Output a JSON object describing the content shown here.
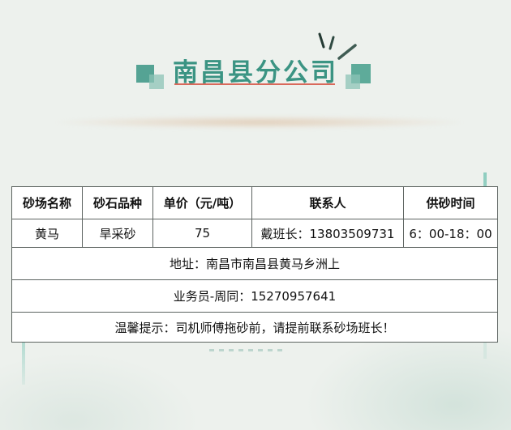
{
  "title": "南昌县分公司",
  "colors": {
    "title": "#3b9483",
    "underline": "#d9695b",
    "accent_square": "#55a394",
    "border": "#5c6360"
  },
  "table": {
    "headers": [
      "砂场名称",
      "砂石品种",
      "单价（元/吨）",
      "联系人",
      "供砂时间"
    ],
    "row": {
      "name": "黄马",
      "type": "旱采砂",
      "price": "75",
      "contact": "戴班长：13803509731",
      "time": "6：00-18：00"
    },
    "address": "地址：南昌市南昌县黄马乡洲上",
    "salesperson": "业务员-周同：15270957641",
    "notice": "温馨提示：司机师傅拖砂前，请提前联系砂场班长！"
  }
}
